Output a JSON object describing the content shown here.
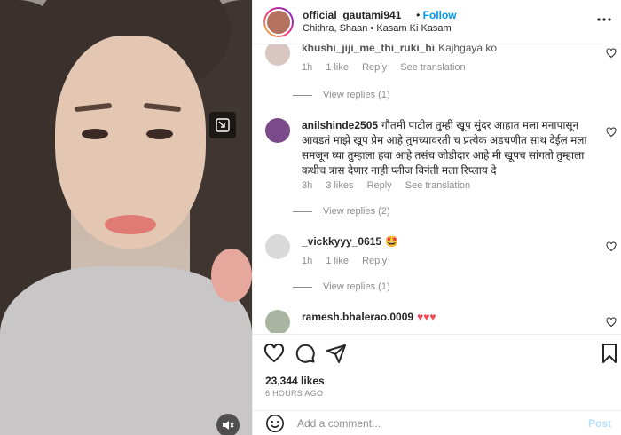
{
  "header": {
    "username": "official_gautami941__",
    "separator": "•",
    "follow_label": "Follow",
    "audio": "Chithra, Shaan • Kasam Ki Kasam"
  },
  "comments": [
    {
      "username": "khushi_jiji_me_thi_ruki_hi",
      "text": "Kajhgaya ko",
      "time": "1h",
      "likes": "1 like",
      "reply_label": "Reply",
      "translation_label": "See translation",
      "view_replies": "View replies (1)"
    },
    {
      "username": "anilshinde2505",
      "text": "गौतमी पाटील तुम्ही खूप सुंदर आहात मला मनापासून आवडतं माझे खूप प्रेम आहे तुमच्यावरती च प्रत्येक अडचणीत साथ देईल मला समजून घ्या तुम्हाला हवा आहे तसंच जोडीदार आहे मी खूपच सांगतो तुम्हाला कधीच त्रास देणार नाही प्लीज विनंती मला रिप्लाय दे",
      "time": "3h",
      "likes": "3 likes",
      "reply_label": "Reply",
      "translation_label": "See translation",
      "view_replies": "View replies (2)"
    },
    {
      "username": "_vickkyyy_0615",
      "text": "🤩",
      "time": "1h",
      "likes": "1 like",
      "reply_label": "Reply",
      "view_replies": "View replies (1)"
    },
    {
      "username": "ramesh.bhalerao.0009",
      "text": "♥♥♥"
    }
  ],
  "stats": {
    "likes": "23,344 likes",
    "posted": "6 HOURS AGO"
  },
  "composer": {
    "placeholder": "Add a comment...",
    "post_label": "Post"
  },
  "icons": {
    "heart": "heart-icon",
    "comment": "comment-icon",
    "share": "share-icon",
    "save": "bookmark-icon",
    "emoji": "emoji-icon",
    "more": "more-icon",
    "pip": "picture-in-picture-icon",
    "mute": "mute-icon"
  },
  "colors": {
    "accent": "#0095f6",
    "heart": "#ed4956",
    "muted": "#8e8e8e"
  }
}
